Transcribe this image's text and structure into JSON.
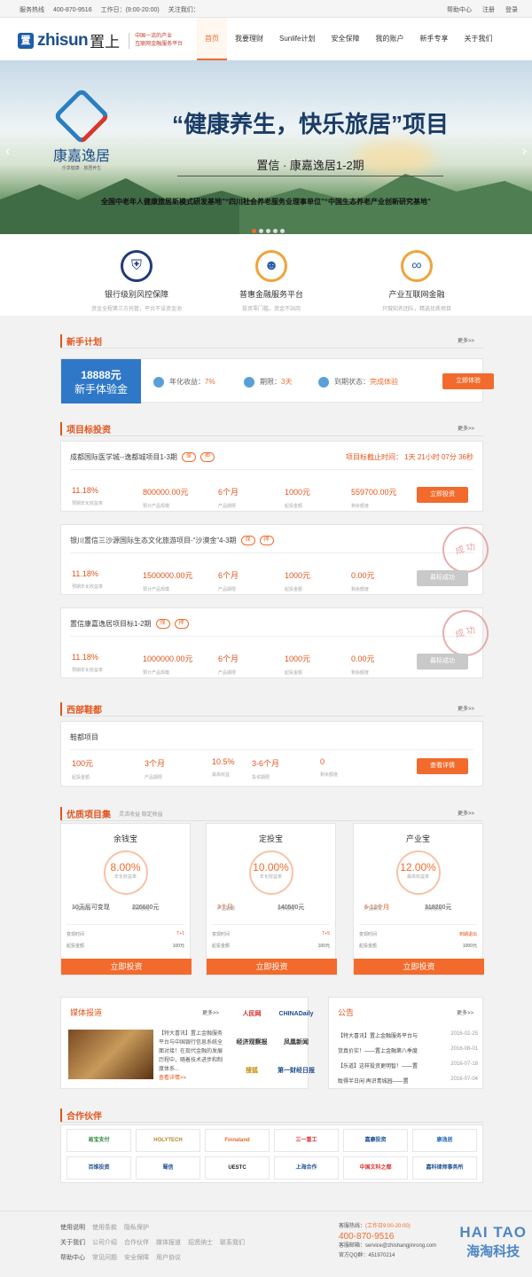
{
  "topbar": {
    "hotline_label": "服务热线",
    "hotline": "400-870-9516",
    "worktime": "工作日：(9:00-20:00)",
    "follow": "关注我们：",
    "help": "帮助中心",
    "register": "注册",
    "login": "登录"
  },
  "header": {
    "logo_en": "zhisun",
    "logo_cn": "置上",
    "logo_mark": "置",
    "slogan1": "中国一流的产业",
    "slogan2": "互联网金融服务平台"
  },
  "nav": [
    "首页",
    "我要理财",
    "Sunlife计划",
    "安全保障",
    "我的账户",
    "新手专享",
    "关于我们"
  ],
  "banner": {
    "brand": "康嘉逸居",
    "brand_sub": "乐享健康 · 旅居养生",
    "title": "“健康养生，快乐旅居”项目",
    "subtitle": "置信 · 康嘉逸居1-2期",
    "foot": "全国中老年人健康旅居新模式研发基地”“四川社会养老服务业理事单位”“中国生态养老产业创新研究基地”"
  },
  "features": [
    {
      "title": "银行级别风控保障",
      "desc": "资金全程第三方托管，平台不设资金池",
      "icon": "shield-icon"
    },
    {
      "title": "普惠金融服务平台",
      "desc": "投资零门槛，资金不站岗",
      "icon": "people-icon"
    },
    {
      "title": "产业互联网金融",
      "desc": "只做知名团队，精选优质项目",
      "icon": "link-icon"
    }
  ],
  "sections": {
    "newbie": "新手计划",
    "project": "项目标投资",
    "west": "西部鞋都",
    "quality": "优质项目集",
    "quality_sub": "灵活收益 稳定收益",
    "more": "更多>>",
    "partners": "合作伙伴"
  },
  "newbie": {
    "amount": "18888元",
    "label": "新手体验金",
    "rate_k": "年化收益：",
    "rate_v": "7%",
    "term_k": "期限：",
    "term_v": "3天",
    "status_k": "到期状态：",
    "status_v": "完成体验",
    "button": "立即体验"
  },
  "projects": [
    {
      "title": "成都国际医学城--逸都城项目1-3期",
      "tag1": "保",
      "tag2": "押",
      "countdown": "项目标截止时间： 1天 21小时 07分 36秒",
      "rate": "11.18%",
      "amount": "800000.00元",
      "term": "6个月",
      "min": "1000元",
      "remain": "559700.00元",
      "button": "立即投资",
      "sold": ""
    },
    {
      "title": "银川置信三沙源国际生态文化旅游项目-“沙漠金”4-3期",
      "tag1": "保",
      "tag2": "押",
      "countdown": "",
      "rate": "11.18%",
      "amount": "1500000.00元",
      "term": "6个月",
      "min": "1000元",
      "remain": "0.00元",
      "button": "募标成功",
      "sold": "成 功"
    },
    {
      "title": "置信康嘉逸居项目标1-2期",
      "tag1": "保",
      "tag2": "押",
      "countdown": "",
      "rate": "11.18%",
      "amount": "1000000.00元",
      "term": "6个月",
      "min": "1000元",
      "remain": "0.00元",
      "button": "募标成功",
      "sold": "成 功"
    }
  ],
  "project_labels": {
    "rate": "预期年化收益率",
    "amount": "预计产品规模",
    "term": "产品期限",
    "min": "起投金额",
    "remain": "剩余额度"
  },
  "west": {
    "title": "鞋都项目",
    "min": "100元",
    "term": "3个月",
    "rate": "10.5%",
    "term2": "3-6个月",
    "remain": "0",
    "button": "查看详情",
    "k_min": "起投金额",
    "k_term": "产品期限",
    "k_rate": "最高收益",
    "k_term2": "投资期限",
    "k_remain": "剩余额度"
  },
  "quality": [
    {
      "name": "余钱宝",
      "rate": "8.00%",
      "rate_k": "年化收益率",
      "a": "10天后可变现",
      "a_k": "产品期限",
      "b": "226600元",
      "b_k": "剩余额度",
      "k1": "变现时间",
      "v1": "T+1",
      "k2": "起投金额",
      "v2": "100元",
      "button": "立即投资"
    },
    {
      "name": "定投宝",
      "rate": "10.00%",
      "rate_k": "年化收益率",
      "a": "3个月",
      "a_k": "产品期限",
      "b": "140500元",
      "b_k": "剩余额度",
      "k1": "变现时间",
      "v1": "T+5",
      "k2": "起投金额",
      "v2": "100元",
      "button": "立即投资"
    },
    {
      "name": "产业宝",
      "rate": "12.00%",
      "rate_k": "最高收益率",
      "a": "6-12个月",
      "a_k": "产品期限",
      "b": "318200元",
      "b_k": "剩余额度",
      "k1": "变现时间",
      "v1": "到期退出",
      "k2": "起投金额",
      "v2": "1000元",
      "button": "立即投资"
    }
  ],
  "media": {
    "title": "媒体报道",
    "more": "更多>>",
    "news": "【特大喜讯】置上金融服务平台与中国银行信息系统全面对接！在现代金融的发展历程中，随着技术进步和制度体系...",
    "read": "查看详情>>",
    "logos": [
      "人民网",
      "CHINADaily",
      "经济观察报",
      "凤凰新闻",
      "搜狐",
      "第一财经日报"
    ]
  },
  "notice": {
    "title": "公告",
    "more": "更多>>",
    "items": [
      {
        "t": "【特大喜讯】置上金融服务平台与",
        "d": "2016-02-25"
      },
      {
        "t": "货真价实！——置上金融第八季度",
        "d": "2016-08-01"
      },
      {
        "t": "【乐道】这样投资更明智！——置",
        "d": "2016-07-18"
      },
      {
        "t": "耽得半日闲 再识青城园——置",
        "d": "2016-07-04"
      }
    ]
  },
  "partners": [
    "易宝支付",
    "HOLYTECH",
    "Finnaland",
    "三一重工",
    "嘉康投资",
    "康逸居",
    "百维投资",
    "蜀信",
    "UESTC",
    "上海合作",
    "中国文科之都",
    "嘉科律师事务所"
  ],
  "footer": {
    "r1": "使用说明",
    "r1a": "使用条款",
    "r1b": "隐私保护",
    "r2": "关于我们",
    "r2a": "公司介绍",
    "r2b": "合作伙伴",
    "r2c": "媒体报道",
    "r2d": "招贤纳士",
    "r2e": "联系我们",
    "r3": "帮助中心",
    "r3a": "常见问题",
    "r3b": "安全保障",
    "r3c": "用户协议",
    "hot_k": "客服热线：",
    "hot_t": "(工作日9:00-20:00)",
    "hot": "400-870-9516",
    "mail": "客服邮箱：service@zhishangjinrong.com",
    "qq": "官方QQ群：451970214"
  },
  "watermark": {
    "a": "HAI TAO",
    "b": "海淘科技"
  },
  "colors": {
    "accent": "#f26b2c",
    "brand": "#1d4f8f",
    "blue": "#2e78c7"
  }
}
